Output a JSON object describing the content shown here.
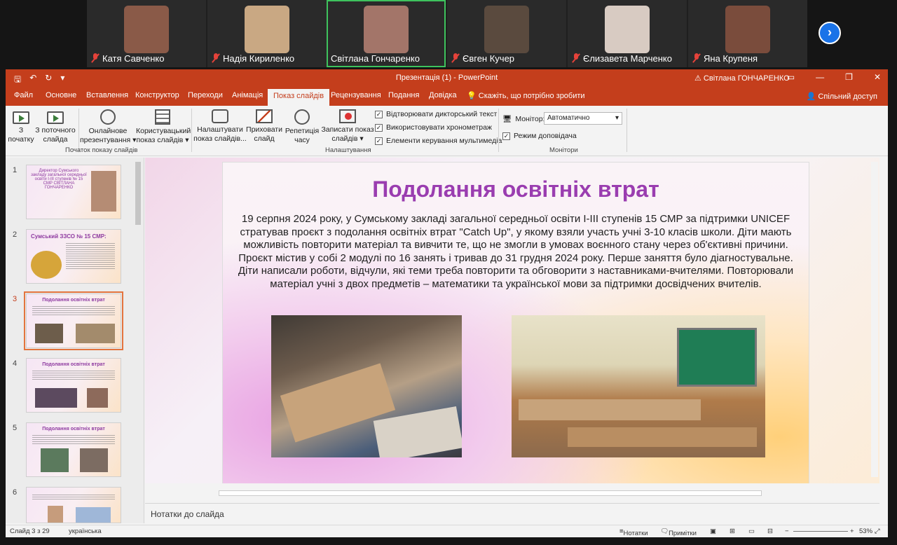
{
  "call": {
    "participants": [
      {
        "name": "Катя Савченко",
        "face": "#8a5a48"
      },
      {
        "name": "Надія Кириленко",
        "face": "#c9a883"
      },
      {
        "name": "Світлана Гончаренко",
        "face": "#a37569"
      },
      {
        "name": "Євген Кучер",
        "face": "#5a4a3e"
      },
      {
        "name": "Єлизавета Марченко",
        "face": "#d8cbc2"
      },
      {
        "name": "Яна Крупеня",
        "face": "#7a4c3c"
      }
    ],
    "active_index": 2,
    "next_label": "›"
  },
  "window": {
    "title": "Презентація (1)  -  PowerPoint",
    "user": "⚠ Світлана ГОНЧАРЕНКО",
    "qat": {
      "save": "🖫",
      "undo": "↶",
      "redo": "↻",
      "more": "▾"
    },
    "controls": {
      "ribbon": "▭",
      "minimize": "—",
      "maximize": "❐",
      "close": "✕"
    }
  },
  "tabs": [
    "Файл",
    "Основне",
    "Вставлення",
    "Конструктор",
    "Переходи",
    "Анімація",
    "Показ слайдів",
    "Рецензування",
    "Подання",
    "Довідка",
    "Скажіть, що потрібно зробити"
  ],
  "selected_tab_index": 6,
  "share_label": "Спільний доступ",
  "ribbon": {
    "from_start": "З\nпочатку",
    "from_current": "З поточного\nслайда",
    "online": "Онлайнове\nпрезентування ▾",
    "custom": "Користувацький\nпоказ слайдів ▾",
    "group1": "Початок показу слайдів",
    "setup": "Налаштувати\nпоказ слайдів...",
    "hide": "Приховати\nслайд",
    "rehearse": "Репетиція\nчасу",
    "record": "Записати показ\nслайдів ▾",
    "chk1": "Відтворювати дикторський текст",
    "chk2": "Використовувати хронометраж",
    "chk3": "Елементи керування мультимедіа",
    "group2": "Налаштування",
    "monitor_label": "Монітор:",
    "monitor_value": "Автоматично",
    "presenter": "Режим доповідача",
    "group3": "Монітори"
  },
  "thumbnails": [
    {
      "num": "1",
      "title": "Директор Сумського закладу загальної середньої освіти І-ІІІ ступенів № 15 СМР СВІТЛАНА ГОНЧАРЕНКО"
    },
    {
      "num": "2",
      "title": "Сумський ЗЗСО № 15 СМР:"
    },
    {
      "num": "3",
      "title": "Подолання освітніх втрат"
    },
    {
      "num": "4",
      "title": "Подолання освітніх втрат"
    },
    {
      "num": "5",
      "title": "Подолання освітніх втрат"
    },
    {
      "num": "6",
      "title": ""
    }
  ],
  "current_slide_index": 2,
  "slide": {
    "title": "Подолання освітніх втрат",
    "body": "19 серпня 2024 року, у Сумському закладі загальної середньої освіти І-ІІІ ступенів 15 СМР  за підтримки UNICEF стратував проєкт з подолання освітніх втрат \"Catch Up\", у якому взяли участь учні 3-10 класів школи. Діти мають можливість повторити матеріал та вивчити те, що не змогли в умовах воєнного стану через об'єктивні причини. Проєкт містив у собі 2 модулі по 16 занять і тривав до 31 грудня 2024 року. Перше заняття було діагностувальне. Діти написали роботи, відчули, які теми треба повторити та обговорити з наставниками-вчителями. Повторювали матеріал учні з двох предметів – математики та української мови за підтримки досвідчених вчителів."
  },
  "notes_label": "Нотатки до слайда",
  "status": {
    "slide_info": "Слайд 3 з 29",
    "language": "українська",
    "notes": "Нотатки",
    "comments": "Примітки",
    "zoom": "53%"
  }
}
